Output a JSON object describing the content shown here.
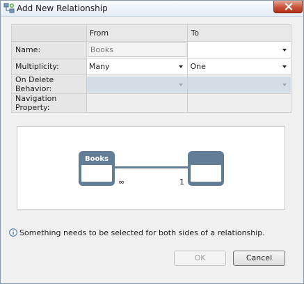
{
  "window": {
    "title": "Add New Relationship"
  },
  "grid": {
    "headers": {
      "from": "From",
      "to": "To"
    },
    "rows": {
      "name": {
        "label": "Name:",
        "from_value": "Books",
        "to_value": ""
      },
      "multiplicity": {
        "label": "Multiplicity:",
        "from_value": "Many",
        "to_value": "One"
      },
      "on_delete": {
        "label": "On Delete Behavior:",
        "from_value": "",
        "to_value": ""
      },
      "navigation": {
        "label": "Navigation Property:",
        "from_value": "",
        "to_value": ""
      }
    }
  },
  "diagram": {
    "left_entity": {
      "title": "Books"
    },
    "right_entity": {
      "title": ""
    },
    "left_multiplicity": "∞",
    "right_multiplicity": "1"
  },
  "info": {
    "icon": "info-icon",
    "message": "Something needs to be selected for both sides of a relationship."
  },
  "buttons": {
    "ok_label": "OK",
    "cancel_label": "Cancel"
  },
  "colors": {
    "entity": "#647d96",
    "disabled_combo": "#d4dde6",
    "close_button": "#c8533c"
  }
}
